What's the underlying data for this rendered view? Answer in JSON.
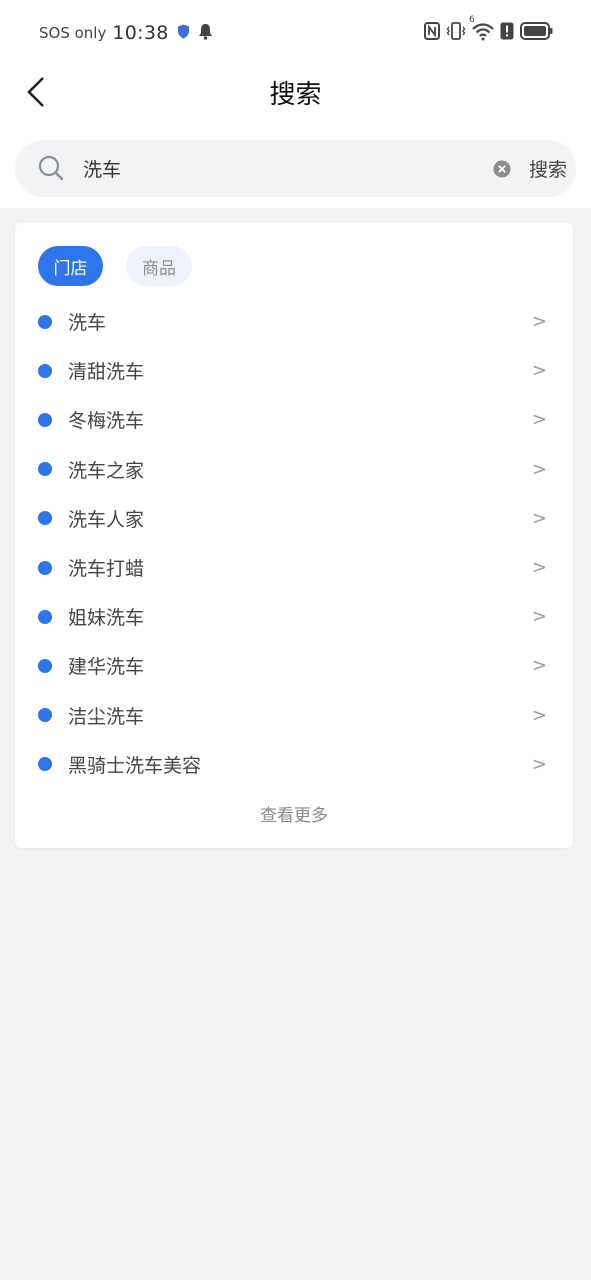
{
  "status_bar": {
    "carrier": "SOS only",
    "time": "10:38",
    "left_icons": [
      "shield-icon",
      "bell-icon"
    ],
    "right_icons": [
      "nfc-icon",
      "vibrate-icon",
      "wifi-icon",
      "alert-icon",
      "battery-icon"
    ],
    "wifi_badge": "6"
  },
  "nav": {
    "title": "搜索",
    "back_icon": "chevron-left-icon"
  },
  "search": {
    "value": "洗车",
    "placeholder": "",
    "submit_label": "搜索",
    "icon": "search-icon",
    "clear_icon": "clear-icon"
  },
  "tabs": [
    {
      "label": "门店",
      "active": true
    },
    {
      "label": "商品",
      "active": false
    }
  ],
  "results": [
    {
      "label": "洗车"
    },
    {
      "label": "清甜洗车"
    },
    {
      "label": "冬梅洗车"
    },
    {
      "label": "洗车之家"
    },
    {
      "label": "洗车人家"
    },
    {
      "label": "洗车打蜡"
    },
    {
      "label": "姐妹洗车"
    },
    {
      "label": "建华洗车"
    },
    {
      "label": "洁尘洗车"
    },
    {
      "label": "黑骑士洗车美容"
    }
  ],
  "result_chevron": ">",
  "more_label": "查看更多",
  "colors": {
    "accent": "#2e74ea",
    "background": "#f2f3f5",
    "card": "#ffffff"
  }
}
